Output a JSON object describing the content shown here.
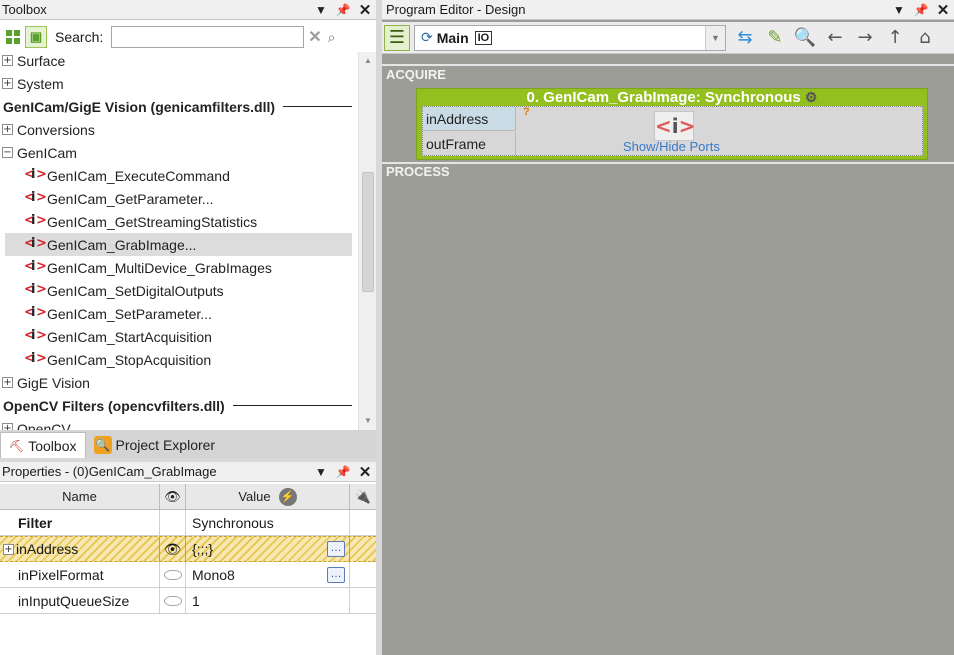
{
  "toolbox": {
    "title": "Toolbox",
    "search_label": "Search:",
    "search_value": "",
    "tree": [
      {
        "label": "Surface",
        "type": "category",
        "expanded": false
      },
      {
        "label": "System",
        "type": "category",
        "expanded": false
      },
      {
        "label": "GenICam/GigE Vision (genicamfilters.dll)",
        "type": "group"
      },
      {
        "label": "Conversions",
        "type": "category",
        "expanded": false
      },
      {
        "label": "GenICam",
        "type": "category",
        "expanded": true
      },
      {
        "label": "GenICam_ExecuteCommand",
        "type": "filter"
      },
      {
        "label": "GenICam_GetParameter...",
        "type": "filter"
      },
      {
        "label": "GenICam_GetStreamingStatistics",
        "type": "filter"
      },
      {
        "label": "GenICam_GrabImage...",
        "type": "filter",
        "selected": true
      },
      {
        "label": "GenICam_MultiDevice_GrabImages",
        "type": "filter"
      },
      {
        "label": "GenICam_SetDigitalOutputs",
        "type": "filter"
      },
      {
        "label": "GenICam_SetParameter...",
        "type": "filter"
      },
      {
        "label": "GenICam_StartAcquisition",
        "type": "filter"
      },
      {
        "label": "GenICam_StopAcquisition",
        "type": "filter"
      },
      {
        "label": "GigE Vision",
        "type": "category",
        "expanded": false
      },
      {
        "label": "OpenCV Filters (opencvfilters.dll)",
        "type": "group"
      },
      {
        "label": "OpenCV",
        "type": "category",
        "expanded": false
      }
    ]
  },
  "bottom_tabs": [
    {
      "label": "Toolbox",
      "active": true
    },
    {
      "label": "Project Explorer",
      "active": false
    }
  ],
  "properties": {
    "title": "Properties - (0)GenICam_GrabImage",
    "col_name": "Name",
    "col_value": "Value",
    "rows": [
      {
        "name": "Filter",
        "value": "Synchronous"
      },
      {
        "name": "inAddress",
        "value": "{;;;}"
      },
      {
        "name": "inPixelFormat",
        "value": "Mono8"
      },
      {
        "name": "inInputQueueSize",
        "value": "1"
      }
    ]
  },
  "editor": {
    "title": "Program Editor - Design",
    "program_name": "Main",
    "io_label": "IO",
    "section_acquire": "ACQUIRE",
    "section_process": "PROCESS",
    "block_title": "0. GenICam_GrabImage: Synchronous",
    "input_port": "inAddress",
    "output_port": "outFrame",
    "show_hide_label": "Show/Hide Ports",
    "question_mark": "?"
  },
  "colors": {
    "block_green": "#93c01f",
    "link_blue": "#3b78c9",
    "filter_icon_red": "#d2252a"
  }
}
